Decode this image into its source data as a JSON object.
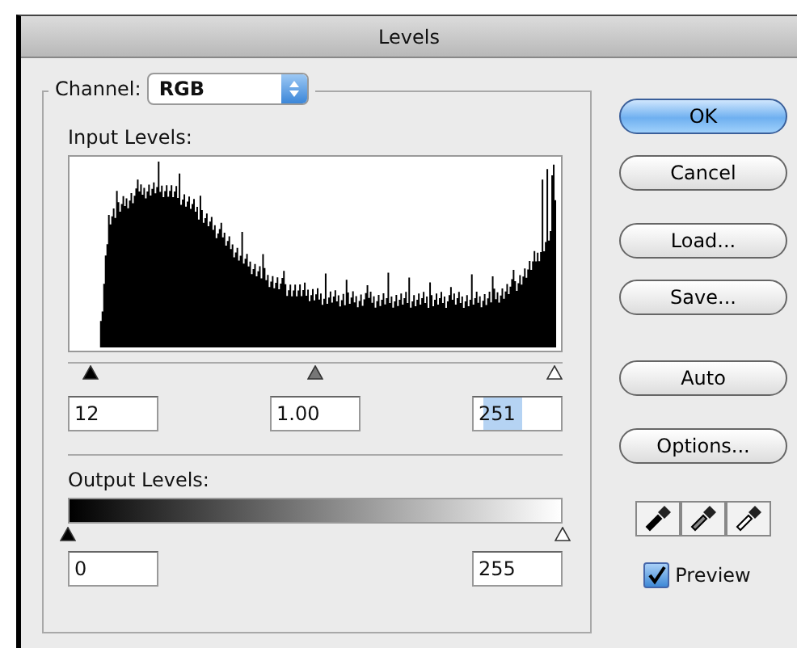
{
  "window": {
    "title": "Levels"
  },
  "channel": {
    "label": "Channel:",
    "value": "RGB"
  },
  "input_levels": {
    "label": "Input Levels:",
    "sliders": [
      {
        "kind": "black",
        "level": 0.047
      },
      {
        "kind": "gray",
        "level": 0.5
      },
      {
        "kind": "white",
        "level": 0.984
      }
    ],
    "fields": [
      {
        "value": "12",
        "selected": false
      },
      {
        "value": "1.00",
        "selected": false
      },
      {
        "value": "251",
        "selected": true
      }
    ]
  },
  "output_levels": {
    "label": "Output Levels:",
    "fields": [
      {
        "value": "0",
        "selected": false
      },
      {
        "value": "255",
        "selected": false
      }
    ]
  },
  "buttons": [
    {
      "label": "OK",
      "default": true
    },
    {
      "label": "Cancel",
      "default": false
    },
    {
      "label": "Load...",
      "default": false
    },
    {
      "label": "Save...",
      "default": false
    },
    {
      "label": "Auto",
      "default": false
    },
    {
      "label": "Options...",
      "default": false
    }
  ],
  "eyedroppers": [
    {
      "kind": "black"
    },
    {
      "kind": "gray"
    },
    {
      "kind": "white"
    }
  ],
  "preview": {
    "label": "Preview",
    "checked": true
  }
}
